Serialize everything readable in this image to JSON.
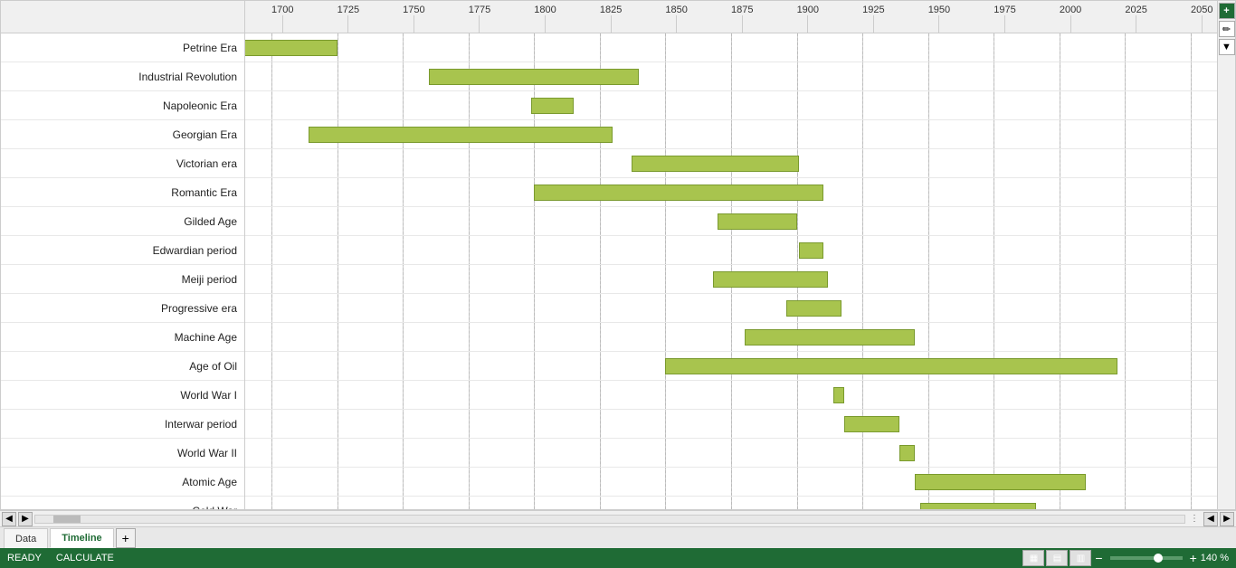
{
  "status": {
    "ready_label": "READY",
    "calculate_label": "CALCULATE",
    "zoom_label": "140 %"
  },
  "tabs": [
    {
      "label": "Data",
      "active": false
    },
    {
      "label": "Timeline",
      "active": true
    }
  ],
  "axis": {
    "years": [
      1700,
      1725,
      1750,
      1775,
      1800,
      1825,
      1850,
      1875,
      1900,
      1925,
      1950,
      1975,
      2000,
      2025,
      2050
    ]
  },
  "rows": [
    {
      "label": "Petrine Era",
      "start": 1682,
      "end": 1725
    },
    {
      "label": "Industrial Revolution",
      "start": 1760,
      "end": 1840
    },
    {
      "label": "Napoleonic Era",
      "start": 1799,
      "end": 1815
    },
    {
      "label": "Georgian Era",
      "start": 1714,
      "end": 1830
    },
    {
      "label": "Victorian era",
      "start": 1837,
      "end": 1901
    },
    {
      "label": "Romantic Era",
      "start": 1800,
      "end": 1910
    },
    {
      "label": "Gilded Age",
      "start": 1870,
      "end": 1900
    },
    {
      "label": "Edwardian period",
      "start": 1901,
      "end": 1910
    },
    {
      "label": "Meiji period",
      "start": 1868,
      "end": 1912
    },
    {
      "label": "Progressive era",
      "start": 1896,
      "end": 1917
    },
    {
      "label": "Machine Age",
      "start": 1880,
      "end": 1945
    },
    {
      "label": "Age of Oil",
      "start": 1850,
      "end": 2022
    },
    {
      "label": "World War I",
      "start": 1914,
      "end": 1918
    },
    {
      "label": "Interwar period",
      "start": 1918,
      "end": 1939
    },
    {
      "label": "World War II",
      "start": 1939,
      "end": 1945
    },
    {
      "label": "Atomic Age",
      "start": 1945,
      "end": 2010
    },
    {
      "label": "Cold War",
      "start": 1947,
      "end": 1991
    }
  ],
  "toolbar": {
    "add_icon": "+",
    "pen_icon": "✏",
    "filter_icon": "▼"
  },
  "scroll": {
    "left_arrow": "◀",
    "right_arrow": "▶",
    "dots": "⋮"
  },
  "view_buttons": [
    "▦",
    "▤",
    "▥"
  ]
}
